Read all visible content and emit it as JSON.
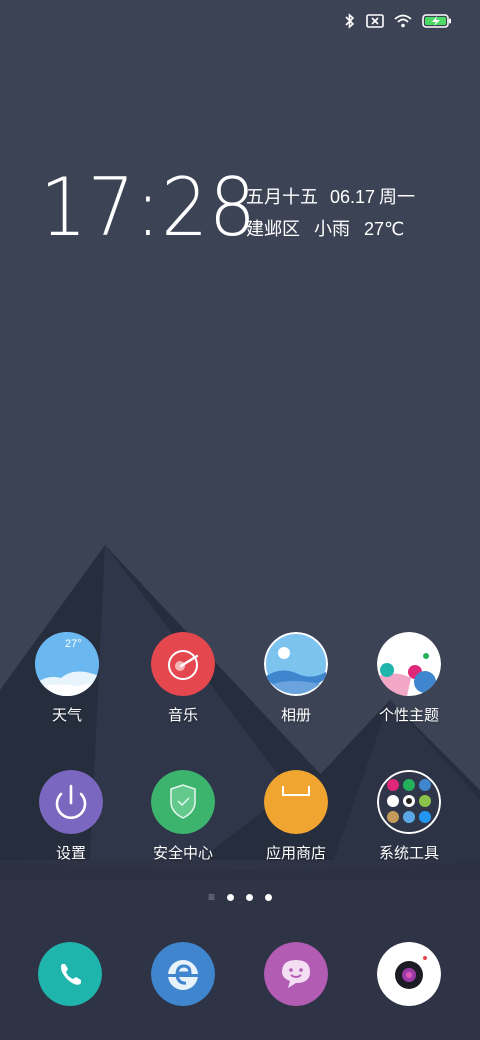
{
  "status_bar": {
    "icons": [
      "bluetooth-icon",
      "no-sim-icon",
      "wifi-icon",
      "battery-charging-icon"
    ],
    "battery_color": "#4cd964"
  },
  "clock": {
    "time": "17:28",
    "lunar_date": "五月十五",
    "date": "06.17",
    "weekday": "周一",
    "location": "建邺区",
    "weather": "小雨",
    "temperature": "27℃"
  },
  "apps_row1": [
    {
      "label": "天气",
      "icon": "weather-icon",
      "badge": "27°"
    },
    {
      "label": "音乐",
      "icon": "music-icon"
    },
    {
      "label": "相册",
      "icon": "gallery-icon"
    },
    {
      "label": "个性主题",
      "icon": "themes-icon"
    }
  ],
  "apps_row2": [
    {
      "label": "设置",
      "icon": "power-settings-icon"
    },
    {
      "label": "安全中心",
      "icon": "security-shield-icon"
    },
    {
      "label": "应用商店",
      "icon": "app-store-icon"
    },
    {
      "label": "系统工具",
      "icon": "system-tools-folder-icon"
    }
  ],
  "page_indicator": {
    "pages": 3,
    "current": 1
  },
  "dock": [
    {
      "icon": "phone-icon"
    },
    {
      "icon": "browser-icon"
    },
    {
      "icon": "messages-icon"
    },
    {
      "icon": "camera-icon"
    }
  ],
  "colors": {
    "background": "#3b4253",
    "mountain_dark": "#242b3b",
    "mountain_mid": "#2e3548",
    "weather": "#6bb7f0",
    "music": "#e5474f",
    "gallery": "#7cc4ee",
    "settings": "#7a68c0",
    "security": "#3db46d",
    "store": "#f0a530",
    "phone": "#1fb5ad",
    "browser": "#3f86cf",
    "messages": "#b25cb3",
    "camera": "#ffffff"
  }
}
